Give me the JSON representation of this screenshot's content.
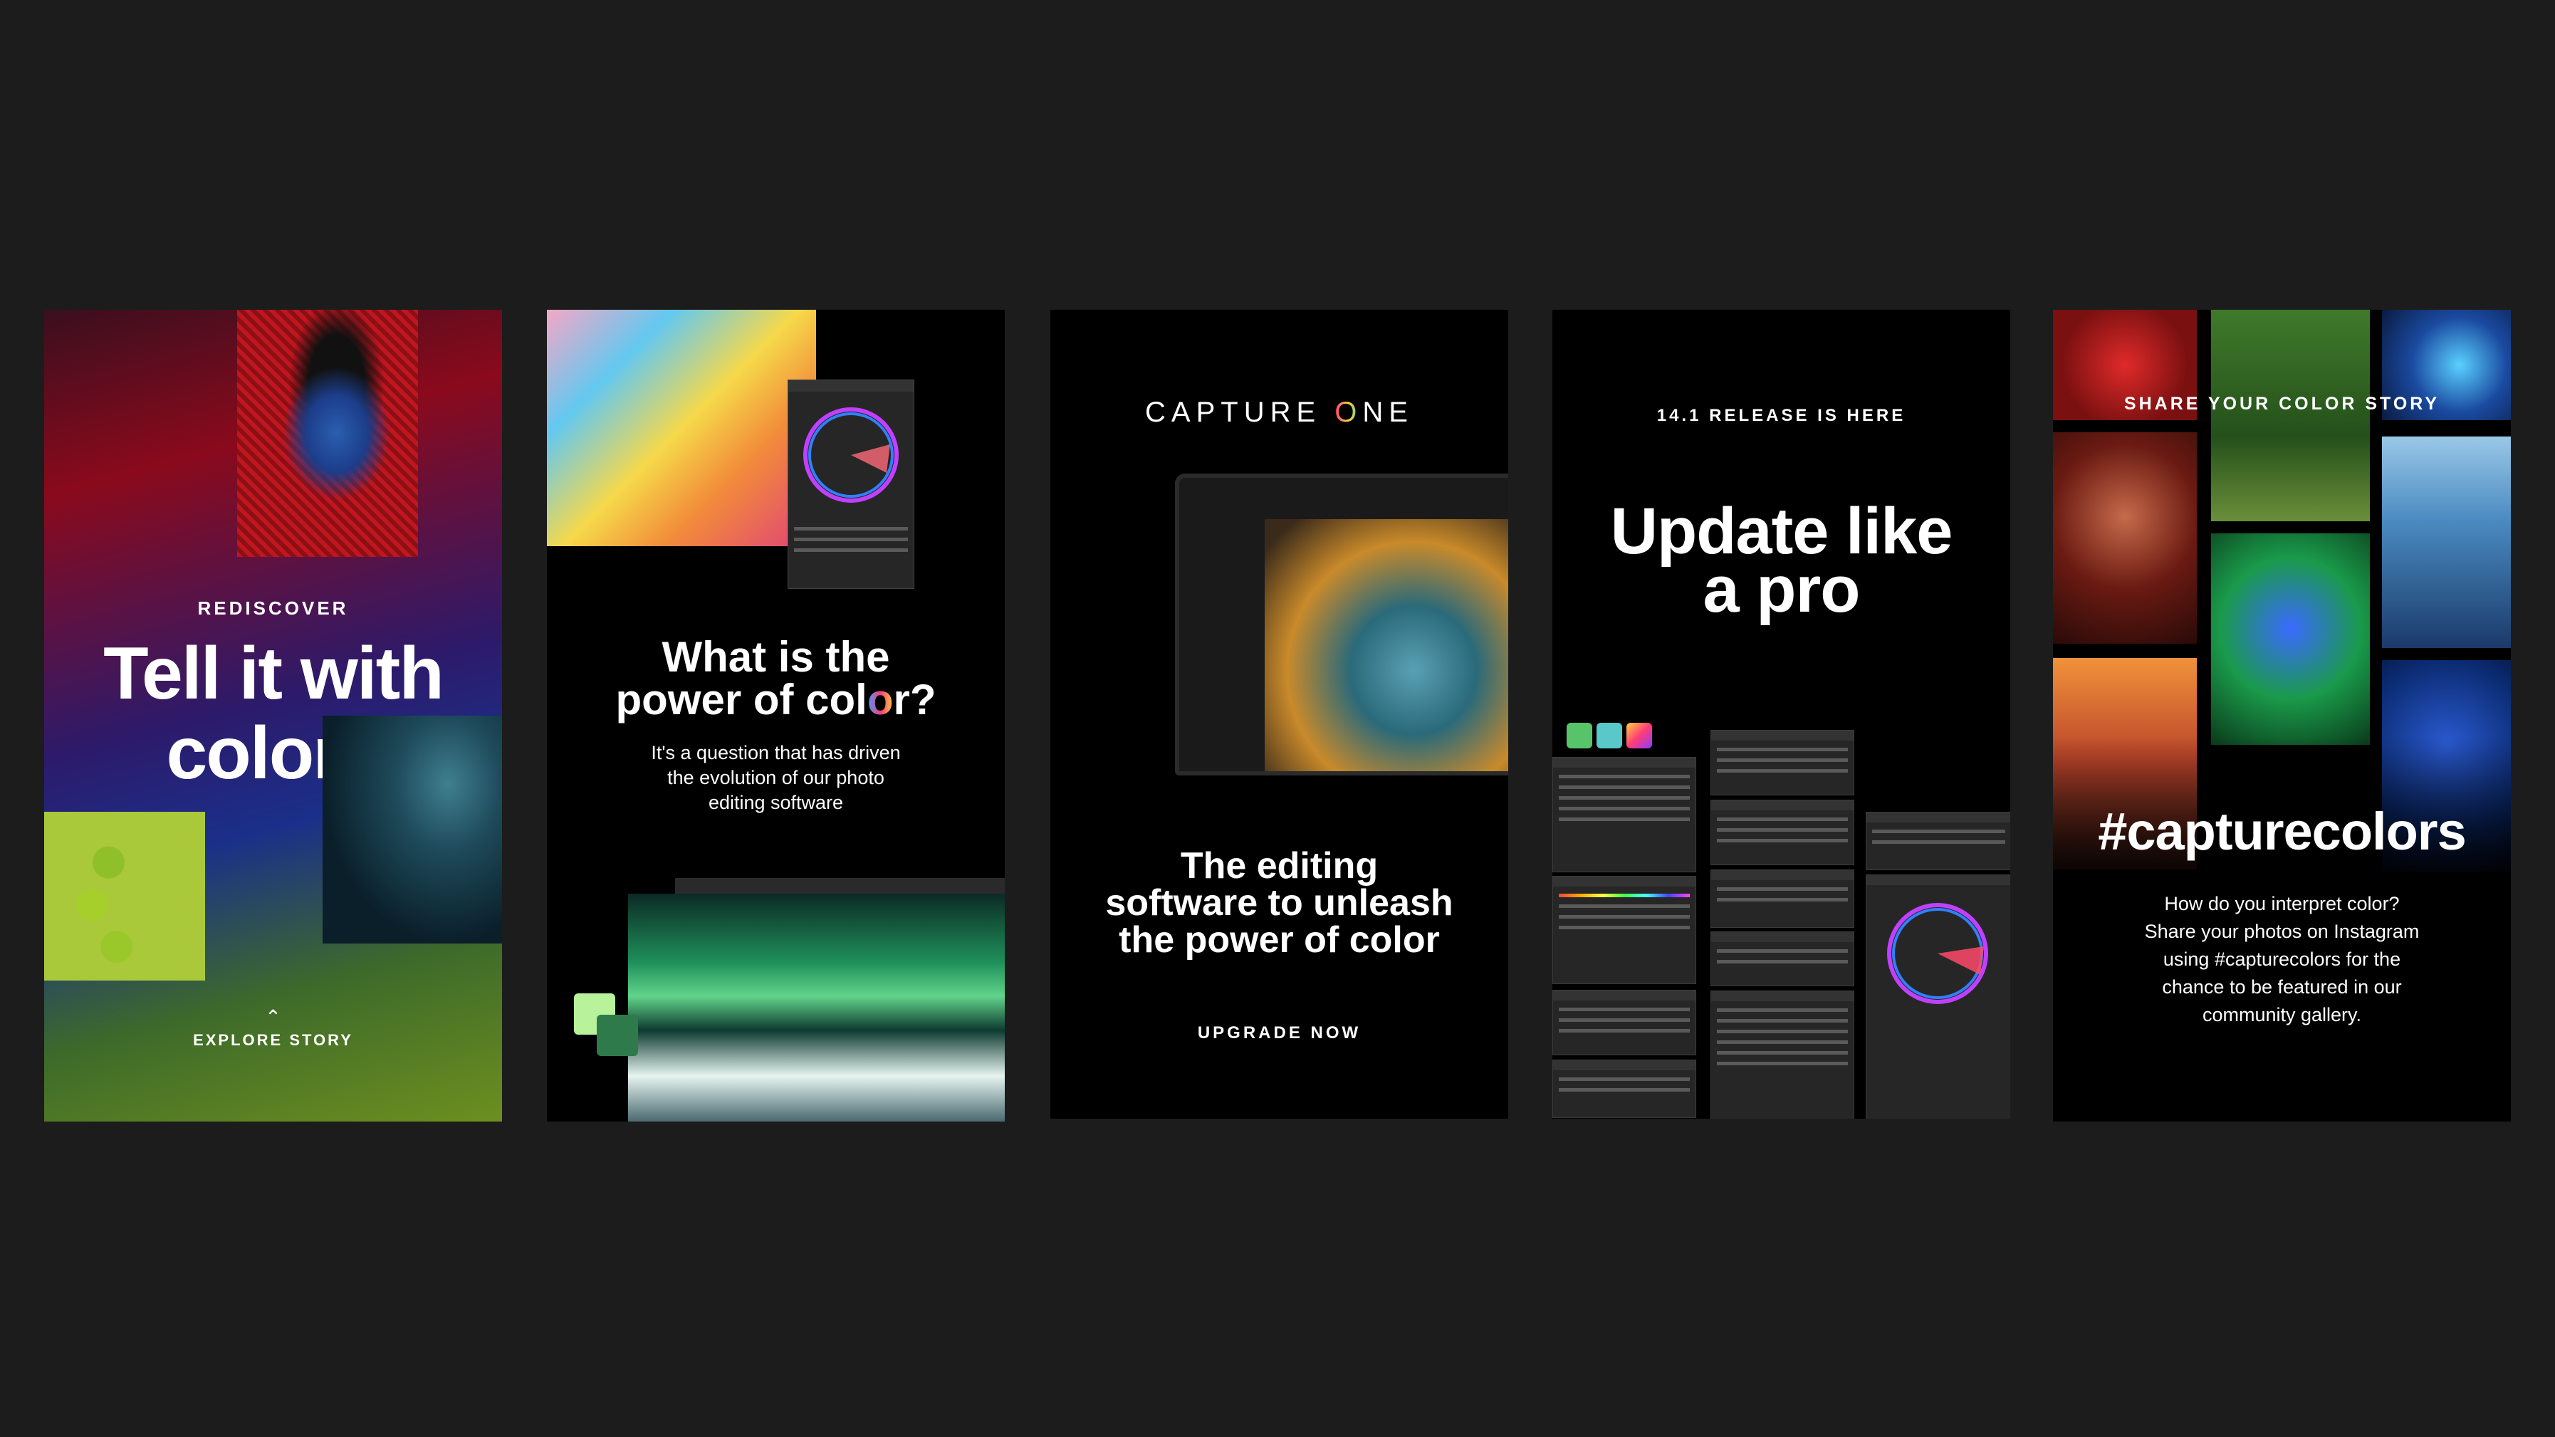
{
  "cards": {
    "story1": {
      "kicker": "REDISCOVER",
      "headline_line1": "Tell it with",
      "headline_line2": "colors",
      "cta": "EXPLORE STORY"
    },
    "story2": {
      "headline_line1": "What is the",
      "headline_line2_pre": "power of col",
      "headline_line2_o": "o",
      "headline_line2_post": "r?",
      "body_line1": "It's a question that has driven",
      "body_line2": "the evolution of our photo",
      "body_line3": "editing software"
    },
    "story3": {
      "logo_pre": "CAPTURE ",
      "logo_o": "O",
      "logo_post": "NE",
      "tagline_line1": "The editing",
      "tagline_line2": "software to unleash",
      "tagline_line3": "the power of color",
      "cta": "UPGRADE NOW"
    },
    "story4": {
      "kicker": "14.1 RELEASE IS HERE",
      "headline_line1": "Update like",
      "headline_line2": "a pro",
      "swatches": [
        "#58c46a",
        "#58c8c8",
        "#d23cff"
      ]
    },
    "story5": {
      "kicker": "SHARE YOUR COLOR STORY",
      "hashtag": "#capturecolors",
      "body_line1": "How do you interpret color?",
      "body_line2": "Share your photos on Instagram",
      "body_line3": "using #capturecolors for the",
      "body_line4": "chance to be featured in our",
      "body_line5": "community gallery."
    }
  },
  "icons": [
    "chevron-up-icon",
    "color-wheel-icon",
    "toolbar-icon"
  ],
  "accent_colors": {
    "background": "#1c1c1c",
    "card": "#000000"
  }
}
